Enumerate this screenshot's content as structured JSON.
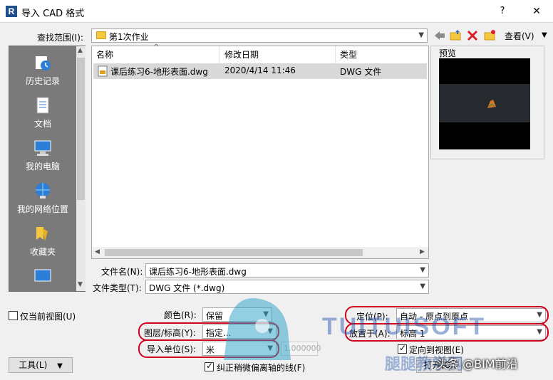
{
  "window": {
    "title": "导入 CAD 格式",
    "app_icon_letter": "R",
    "help": "?",
    "close": "✕"
  },
  "lookin": {
    "label": "查找范围(I):",
    "value": "第1次作业"
  },
  "toolbar": {
    "view_label": "查看(V)"
  },
  "places": [
    {
      "label": "历史记录",
      "icon": "history-icon"
    },
    {
      "label": "文档",
      "icon": "documents-icon"
    },
    {
      "label": "我的电脑",
      "icon": "computer-icon"
    },
    {
      "label": "我的网络位置",
      "icon": "network-icon"
    },
    {
      "label": "收藏夹",
      "icon": "favorites-icon"
    }
  ],
  "filelist": {
    "columns": [
      "名称",
      "修改日期",
      "类型"
    ],
    "rows": [
      {
        "name": "课后练习6-地形表面.dwg",
        "date": "2020/4/14 11:46",
        "type": "DWG 文件"
      }
    ]
  },
  "preview": {
    "label": "预览"
  },
  "filename": {
    "label": "文件名(N):",
    "value": "课后练习6-地形表面.dwg"
  },
  "filetype": {
    "label": "文件类型(T):",
    "value": "DWG 文件  (*.dwg)"
  },
  "options": {
    "current_view_only": "仅当前视图(U)",
    "color_label": "颜色(R):",
    "color_value": "保留",
    "layers_label": "图层/标高(Y):",
    "layers_value": "指定...",
    "units_label": "导入单位(S):",
    "units_value": "米",
    "units_factor": "1.000000",
    "correct_lines": "纠正稍微偏离轴的线(F)",
    "position_label": "定位(P):",
    "position_value": "自动 - 原点到原点",
    "place_at_label": "放置于(A):",
    "place_at_value": "标高 1",
    "orient_to_view": "定向到视图(E)"
  },
  "buttons": {
    "tools": "工具(L)",
    "open": "打开(O)"
  },
  "watermark": {
    "brand": "TUITUISOFT",
    "brand_cn": "腿腿教学网",
    "credit": "头条 @BIM前沿"
  },
  "colors": {
    "red_highlight": "#d0021b",
    "selection": "#d9d9d9",
    "places_bg": "#7a7a7a"
  }
}
